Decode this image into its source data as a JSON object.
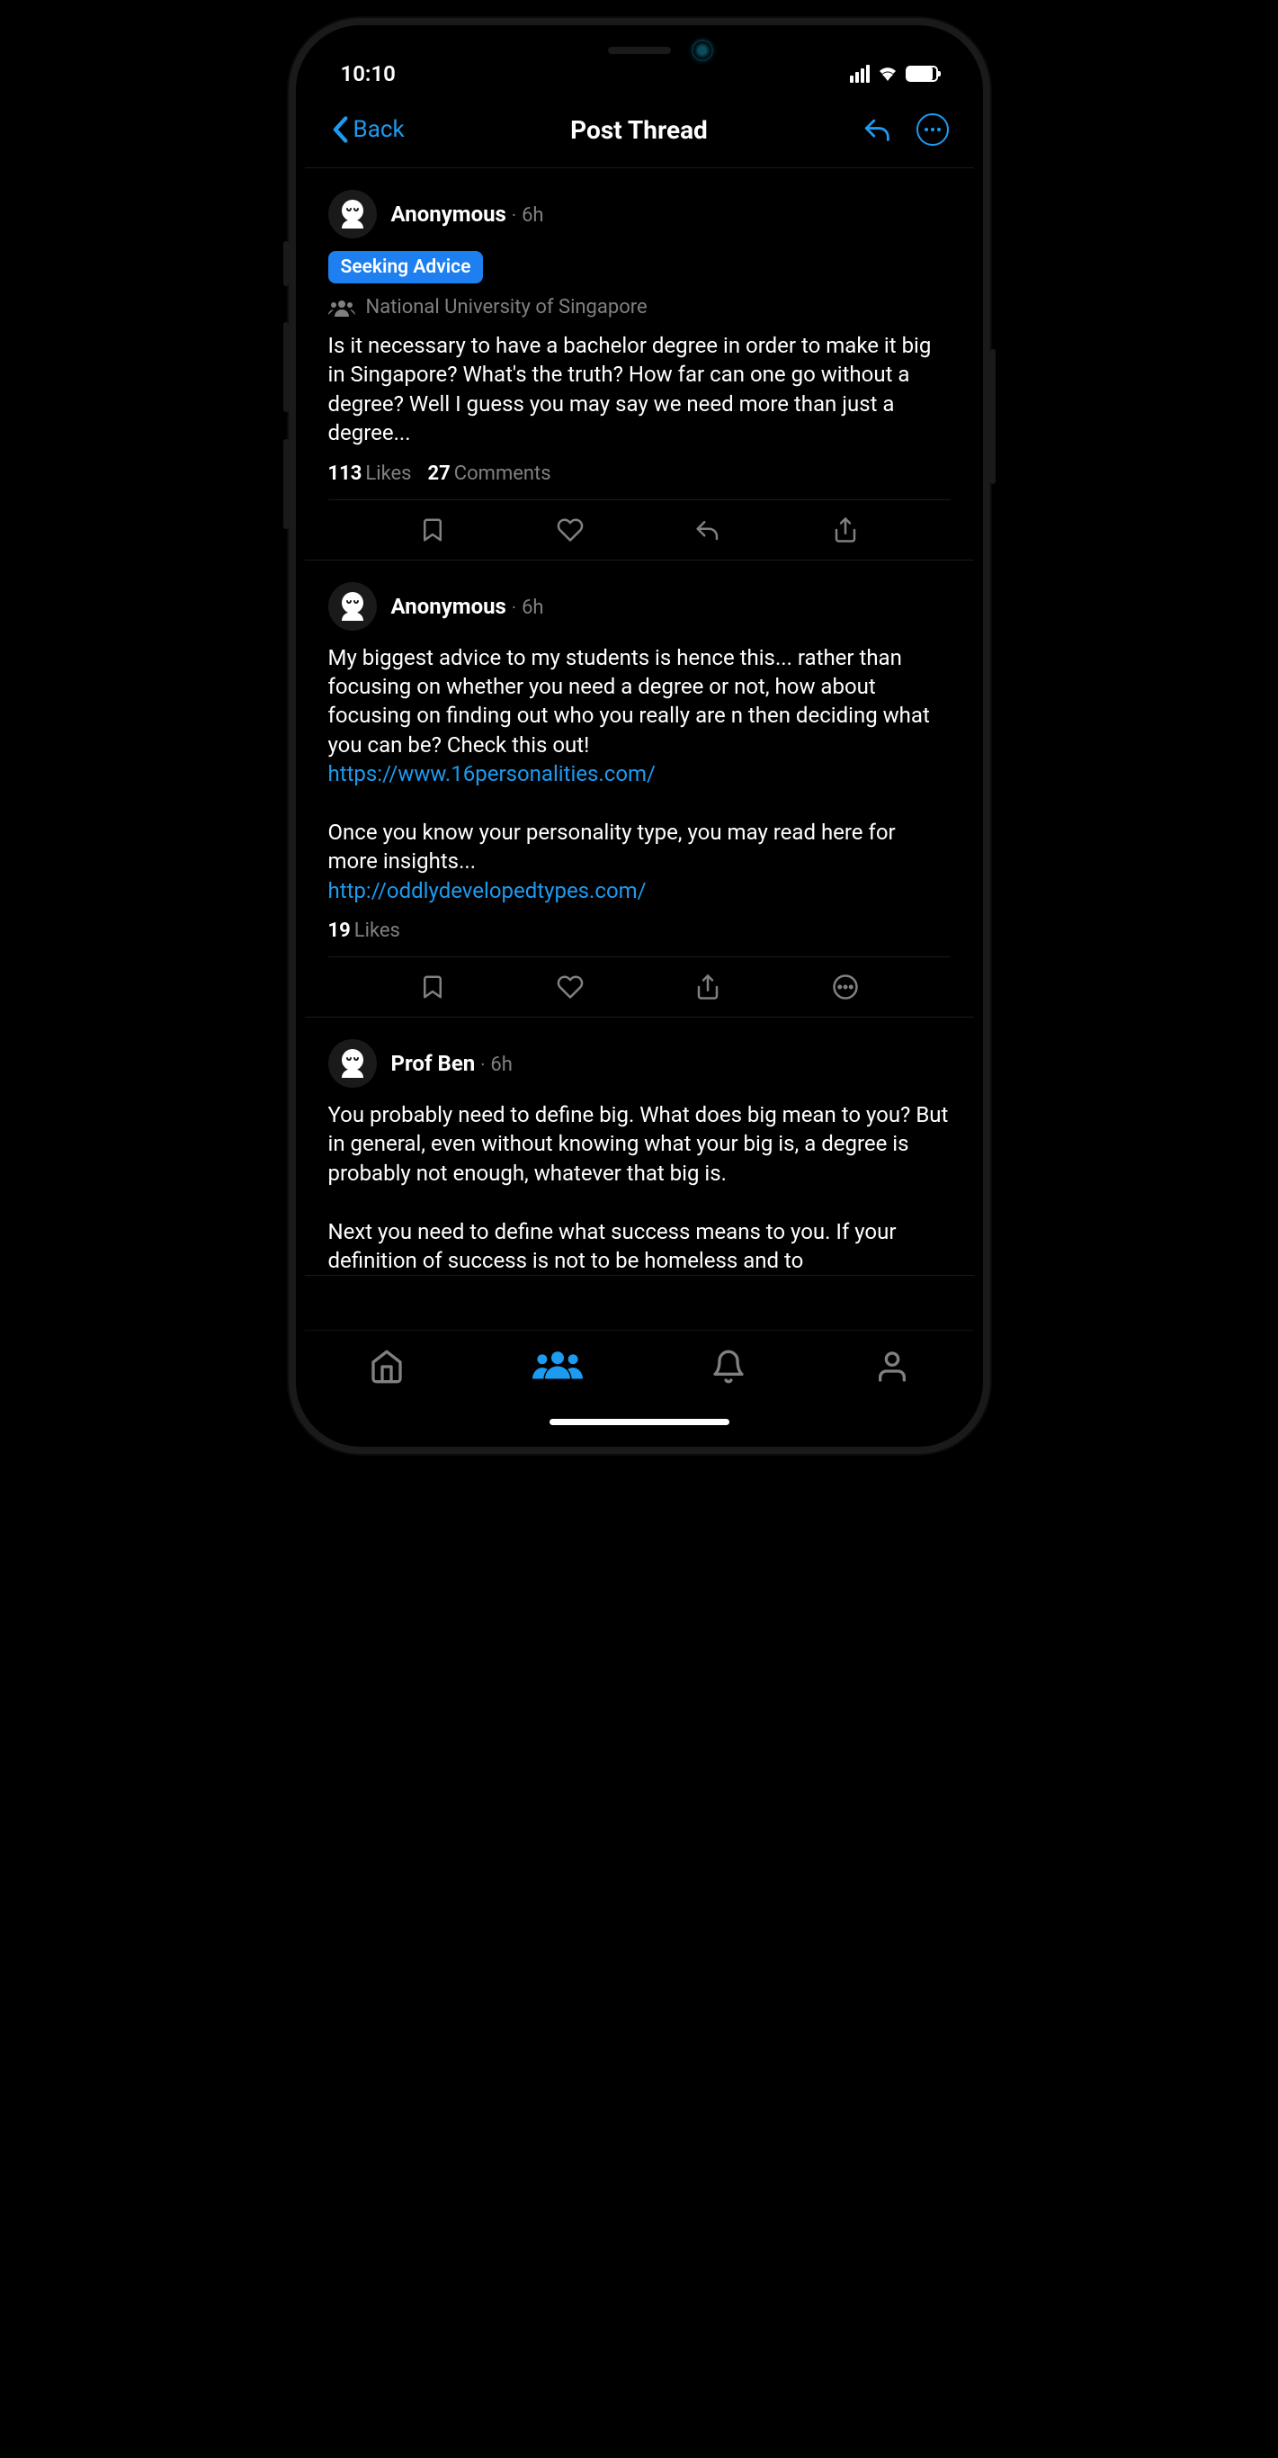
{
  "statusBar": {
    "time": "10:10"
  },
  "header": {
    "back": "Back",
    "title": "Post Thread"
  },
  "posts": [
    {
      "user": "Anonymous",
      "time": "6h",
      "tag": "Seeking Advice",
      "community": "National University of Singapore",
      "body": "Is it necessary to have a bachelor degree in order to make it big in Singapore? What's the truth? How far can one go without a degree? Well I guess you may say we need more than just a degree...",
      "likes": "113",
      "likesLabel": "Likes",
      "comments": "27",
      "commentsLabel": "Comments",
      "actions": [
        "bookmark",
        "heart",
        "reply",
        "share"
      ]
    },
    {
      "user": "Anonymous",
      "time": "6h",
      "bodyPart1": "My biggest advice to my students is hence this... rather than focusing on whether you need a degree or not, how about focusing on finding out who you really are n then deciding what you can be? Check this out!",
      "link1": "https://www.16personalities.com/",
      "bodyPart2": "Once you know your personality type, you may read here for more insights...",
      "link2": "http://oddlydevelopedtypes.com/",
      "likes": "19",
      "likesLabel": "Likes",
      "actions": [
        "bookmark",
        "heart",
        "share",
        "more"
      ]
    },
    {
      "user": "Prof Ben",
      "time": "6h",
      "bodyPart1": "You probably need to define big. What does big mean to you? But in general, even without knowing what your big is, a degree is probably not enough, whatever that big is.",
      "bodyPart2": "Next you need to define what success means to you. If your definition of success is not to be homeless and to"
    }
  ]
}
